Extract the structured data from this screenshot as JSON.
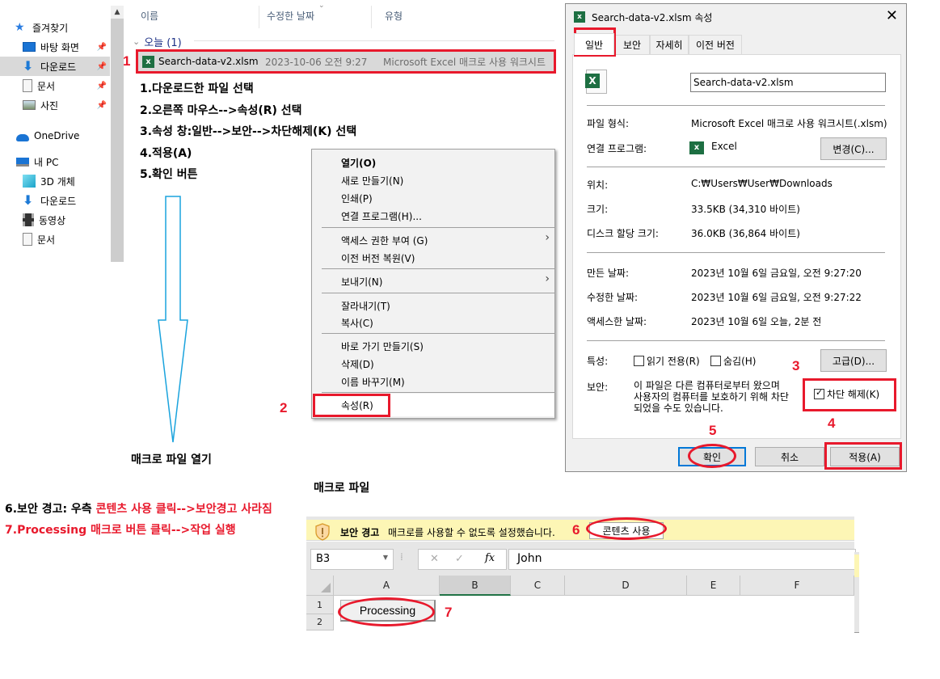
{
  "explorer": {
    "nav": {
      "quick_access": "즐겨찾기",
      "items_pinned": [
        {
          "label": "바탕 화면",
          "icon": "desktop-icon"
        },
        {
          "label": "다운로드",
          "icon": "download-icon",
          "selected": true
        },
        {
          "label": "문서",
          "icon": "document-icon"
        },
        {
          "label": "사진",
          "icon": "pictures-icon"
        }
      ],
      "onedrive": "OneDrive",
      "this_pc": "내 PC",
      "pc_items": [
        {
          "label": "3D 개체",
          "icon": "3d-objects-icon"
        },
        {
          "label": "다운로드",
          "icon": "download-icon"
        },
        {
          "label": "동영상",
          "icon": "video-icon"
        },
        {
          "label": "문서",
          "icon": "document-icon"
        }
      ]
    },
    "columns": {
      "name": "이름",
      "modified": "수정한 날짜",
      "type": "유형"
    },
    "group_label": "오늘 (1)",
    "file": {
      "name": "Search-data-v2.xlsm",
      "modified": "2023-10-06 오전 9:27",
      "type": "Microsoft Excel 매크로 사용 워크시트"
    }
  },
  "instructions": [
    "1.다운로드한 파일 선택",
    "2.오른쪽 마우스-->속성(R) 선택",
    "3.속성 창:일반-->보안-->차단해제(K) 선택",
    "4.적용(A)",
    "5.확인 버튼"
  ],
  "context_menu": {
    "groups": [
      [
        {
          "label": "열기(O)",
          "bold": true
        },
        {
          "label": "새로 만들기(N)"
        },
        {
          "label": "인쇄(P)"
        },
        {
          "label": "연결 프로그램(H)..."
        }
      ],
      [
        {
          "label": "액세스 권한 부여 (G)",
          "submenu": true
        },
        {
          "label": "이전 버전 복원(V)"
        }
      ],
      [
        {
          "label": "보내기(N)",
          "submenu": true
        }
      ],
      [
        {
          "label": "잘라내기(T)"
        },
        {
          "label": "복사(C)"
        }
      ],
      [
        {
          "label": "바로 가기 만들기(S)"
        },
        {
          "label": "삭제(D)"
        },
        {
          "label": "이름 바꾸기(M)"
        }
      ],
      [
        {
          "label": "속성(R)"
        }
      ]
    ]
  },
  "arrow_caption": "매크로 파일 열기",
  "properties_dialog": {
    "title": "Search-data-v2.xlsm 속성",
    "tabs": [
      "일반",
      "보안",
      "자세히",
      "이전 버전"
    ],
    "active_tab": "일반",
    "filename": "Search-data-v2.xlsm",
    "fields": {
      "file_type_label": "파일 형식:",
      "file_type": "Microsoft Excel 매크로 사용 워크시트(.xlsm)",
      "opens_with_label": "연결 프로그램:",
      "opens_with": "Excel",
      "change_button": "변경(C)...",
      "location_label": "위치:",
      "location": "C:₩Users₩User₩Downloads",
      "size_label": "크기:",
      "size": "33.5KB (34,310 바이트)",
      "size_on_disk_label": "디스크 할당 크기:",
      "size_on_disk": "36.0KB (36,864 바이트)",
      "created_label": "만든 날짜:",
      "created": "2023년 10월 6일 금요일, 오전 9:27:20",
      "modified_label": "수정한 날짜:",
      "modified": "2023년 10월 6일 금요일, 오전 9:27:22",
      "accessed_label": "액세스한 날짜:",
      "accessed": "2023년 10월 6일 오늘, 2분 전",
      "attributes_label": "특성:",
      "readonly_label": "읽기 전용(R)",
      "readonly_checked": false,
      "hidden_label": "숨김(H)",
      "hidden_checked": false,
      "advanced_button": "고급(D)...",
      "security_label": "보안:",
      "security_text_1": "이 파일은 다른 컴퓨터로부터 왔으며",
      "security_text_2": "사용자의 컴퓨터를 보호하기 위해 차단",
      "security_text_3": "되었을 수도 있습니다.",
      "unblock_label": "차단 해제(K)",
      "unblock_checked": true
    },
    "buttons": {
      "ok": "확인",
      "cancel": "취소",
      "apply": "적용(A)"
    }
  },
  "annotations": {
    "n1": "1",
    "n2": "2",
    "n3": "3",
    "n4": "4",
    "n5": "5",
    "n6": "6",
    "n7": "7"
  },
  "bottom_notes": {
    "step6_prefix": "6.보안 경고: 우측 ",
    "step6_red": "콘텐츠 사용 클릭-->보안경고 사라짐",
    "step7_prefix": "7.",
    "step7_red": "Processing 매크로 버튼 클릭-->작업 실행"
  },
  "excel": {
    "caption": "매크로 파일",
    "security_bar": {
      "title": "보안 경고",
      "message": "매크로를 사용할 수 없도록 설정했습니다.",
      "button": "콘텐츠 사용"
    },
    "name_box": "B3",
    "formula": "John",
    "columns": [
      "A",
      "B",
      "C",
      "D",
      "E",
      "F"
    ],
    "rows": [
      "1",
      "2"
    ],
    "macro_button": "Processing"
  },
  "colors": {
    "accent_red": "#e8192c",
    "arrow_blue": "#1aa3dd",
    "security_bar": "#fdf6b5",
    "excel_green": "#217346"
  }
}
